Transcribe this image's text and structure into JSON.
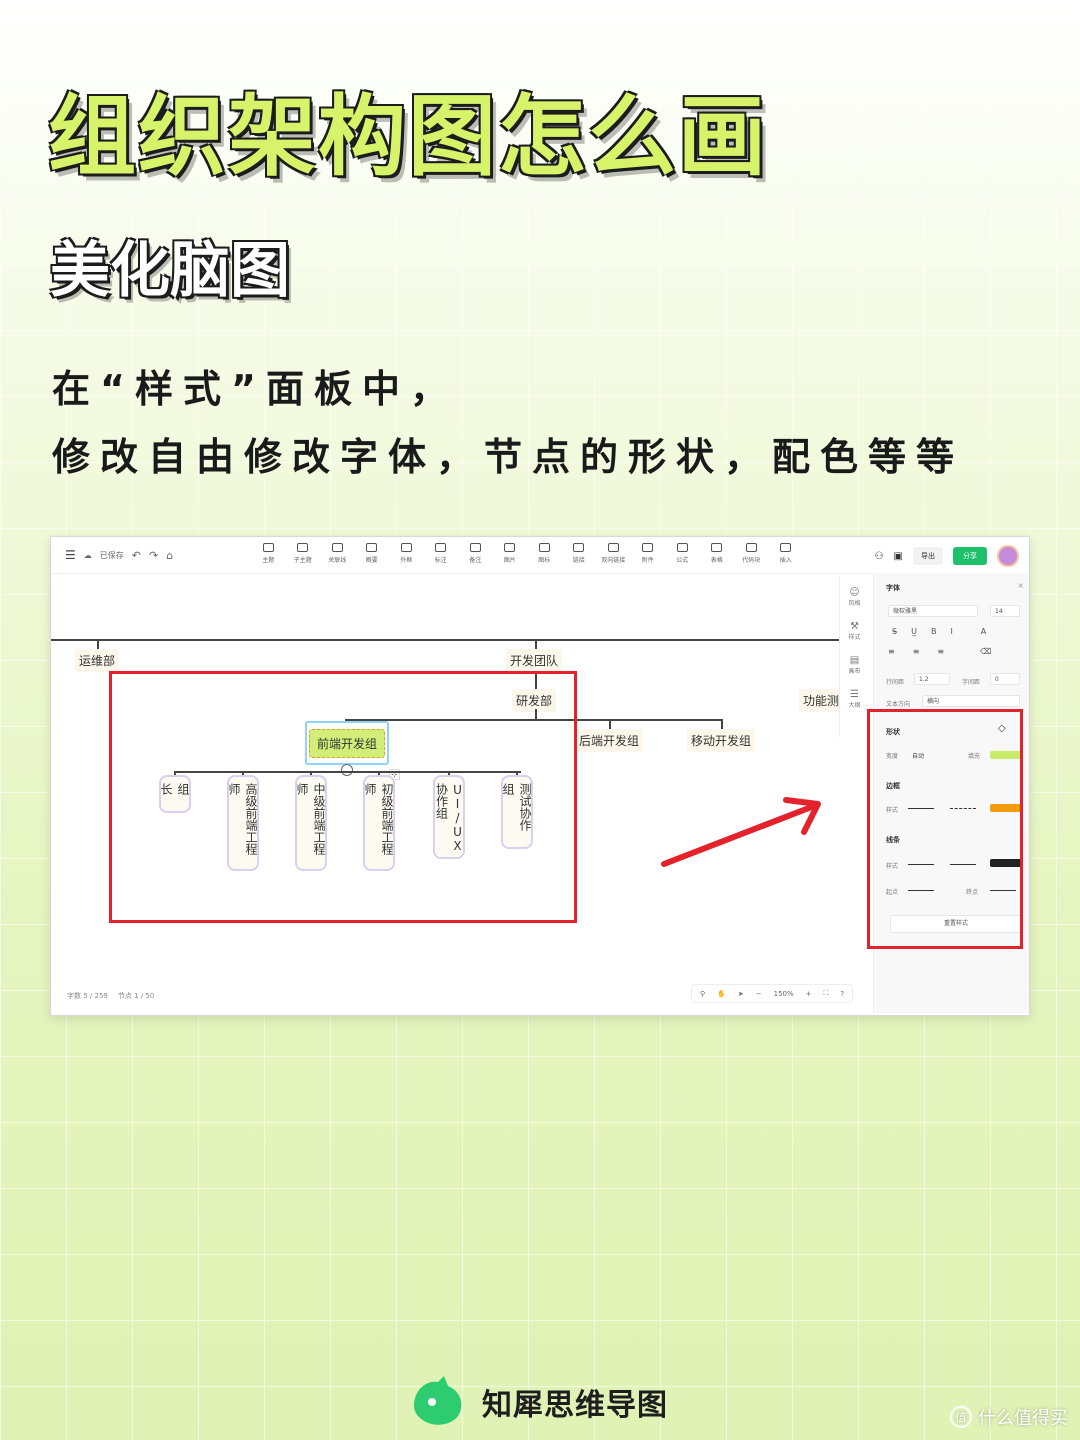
{
  "title": "组织架构图怎么画",
  "subtitle": "美化脑图",
  "description": {
    "line1": "在“样式”面板中，",
    "line2": "修改自由修改字体，节点的形状，配色等等"
  },
  "app": {
    "saved_label": "已保存",
    "toolbar": [
      "主题",
      "子主题",
      "关联线",
      "概要",
      "外框",
      "标注",
      "备注",
      "图片",
      "图标",
      "链接",
      "双向链接",
      "附件",
      "公式",
      "表格",
      "代码块",
      "插入"
    ],
    "export_label": "导出",
    "share_label": "分享",
    "status_words": "字数  5 / 259",
    "status_nodes": "节点  1 / 50",
    "zoom": "150%"
  },
  "mindmap": {
    "ops": "运维部",
    "dev_team": "开发团队",
    "rnd": "研发部",
    "func_test": "功能测试组",
    "frontend": "前端开发组",
    "backend": "后端开发组",
    "mobile": "移动开发组",
    "children": [
      "组长",
      "高级前端工程师",
      "中级前端工程师",
      "初级前端工程师",
      "UI/UX协作组",
      "测试协作组"
    ]
  },
  "side_icons": [
    "风格",
    "样式",
    "画布",
    "大纲"
  ],
  "panel": {
    "font_title": "字体",
    "font_name": "微软雅黑",
    "font_size": "14",
    "line_height_label": "行间距",
    "line_height": "1.2",
    "letter_spacing_label": "字间距",
    "letter_spacing": "0",
    "text_dir_label": "文本方向",
    "text_dir": "横向",
    "shape_title": "形状",
    "width_label": "宽度",
    "width_val": "自动",
    "fill_label": "填充",
    "border_title": "边框",
    "style_label": "样式",
    "line_title": "线条",
    "start_label": "起点",
    "end_label": "终点",
    "reset_label": "重置样式"
  },
  "colors": {
    "fill": "#c8ec6a",
    "border": "#f39a12",
    "line": "#222222",
    "accent_red": "#e4222b",
    "share_green": "#1fc06b"
  },
  "brand": "知犀思维导图",
  "watermark": "什么值得买"
}
